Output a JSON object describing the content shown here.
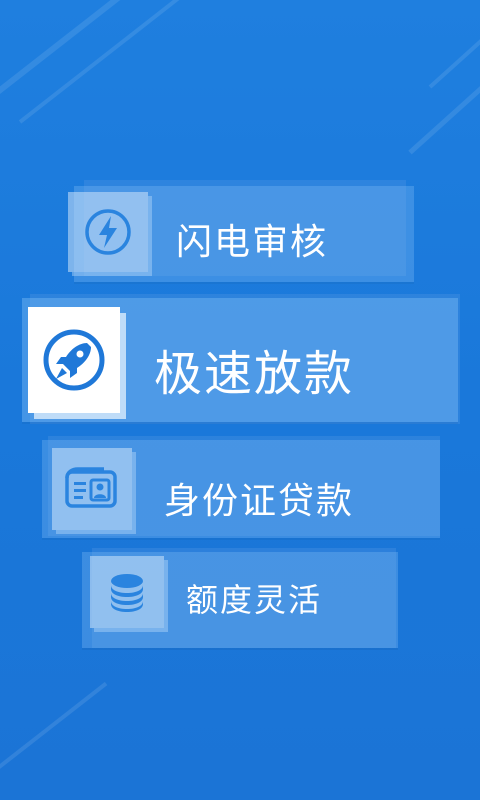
{
  "menu": {
    "items": [
      {
        "label": "闪电审核",
        "icon": "lightning-icon",
        "active": false
      },
      {
        "label": "极速放款",
        "icon": "rocket-icon",
        "active": true
      },
      {
        "label": "身份证贷款",
        "icon": "id-card-icon",
        "active": false
      },
      {
        "label": "额度灵活",
        "icon": "coin-stack-icon",
        "active": false
      }
    ]
  },
  "colors": {
    "background": "#1a78da",
    "active_icon": "#1f78d8",
    "inactive_icon": "#2a84df",
    "text": "#ffffff"
  }
}
